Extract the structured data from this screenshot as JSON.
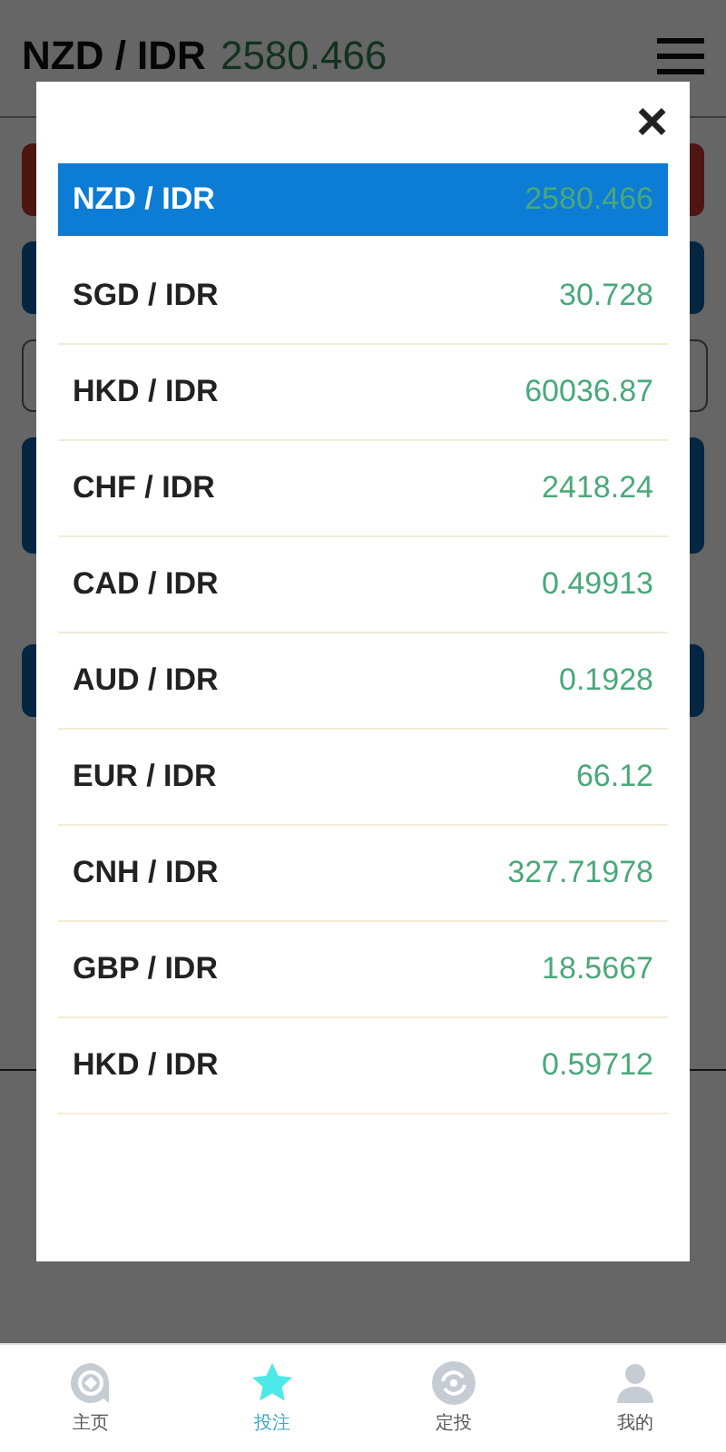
{
  "header": {
    "pair": "NZD / IDR",
    "rate": "2580.466"
  },
  "modal": {
    "close": "×",
    "rates": [
      {
        "pair": "NZD / IDR",
        "value": "2580.466",
        "selected": true
      },
      {
        "pair": "SGD / IDR",
        "value": "30.728",
        "selected": false
      },
      {
        "pair": "HKD / IDR",
        "value": "60036.87",
        "selected": false
      },
      {
        "pair": "CHF / IDR",
        "value": "2418.24",
        "selected": false
      },
      {
        "pair": "CAD / IDR",
        "value": "0.49913",
        "selected": false
      },
      {
        "pair": "AUD / IDR",
        "value": "0.1928",
        "selected": false
      },
      {
        "pair": "EUR / IDR",
        "value": "66.12",
        "selected": false
      },
      {
        "pair": "CNH / IDR",
        "value": "327.71978",
        "selected": false
      },
      {
        "pair": "GBP / IDR",
        "value": "18.5667",
        "selected": false
      },
      {
        "pair": "HKD / IDR",
        "value": "0.59712",
        "selected": false
      }
    ]
  },
  "tabs": [
    {
      "label": "主页",
      "kind": "home",
      "selected": false
    },
    {
      "label": "投注",
      "kind": "star",
      "selected": true
    },
    {
      "label": "定投",
      "kind": "cycle",
      "selected": false
    },
    {
      "label": "我的",
      "kind": "user",
      "selected": false
    }
  ]
}
